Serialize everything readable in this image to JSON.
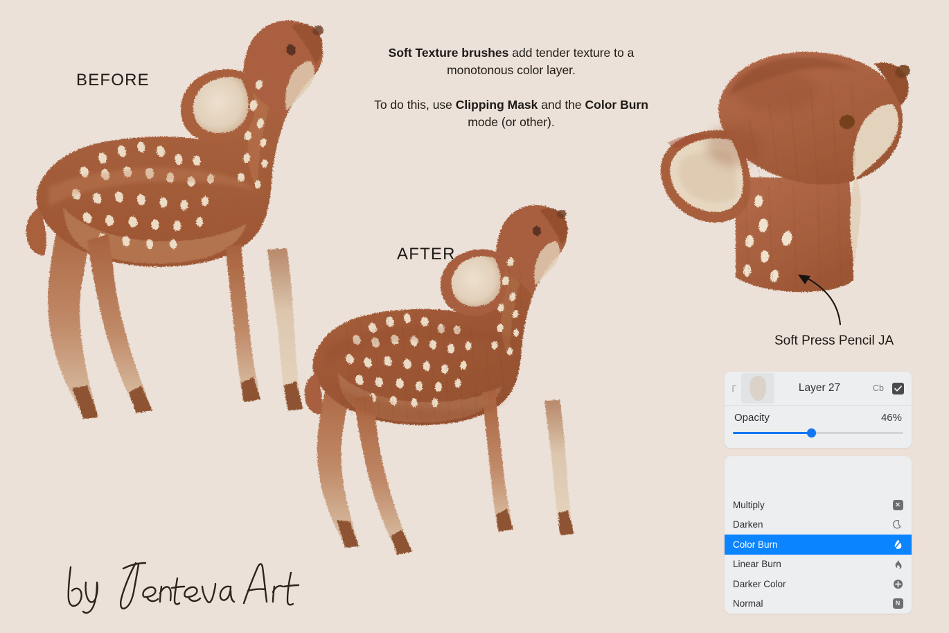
{
  "page": {
    "background_color": "#ece1d8",
    "text_color": "#1d1a17"
  },
  "labels": {
    "before": "BEFORE",
    "after": "AFTER"
  },
  "instructions": {
    "line1_bold": "Soft Texture brushes",
    "line1_rest": " add tender texture to a",
    "line2": "monotonous color layer.",
    "line3_a": "To do this, use ",
    "line3_bold1": "Clipping Mask",
    "line3_b": " and the ",
    "line3_bold2": "Color Burn",
    "line4": "mode (or other)."
  },
  "brush_caption": "Soft Press Pencil JA",
  "signature": "by Jenteva Art",
  "layer_panel": {
    "clip_glyph": "Γ",
    "layer_name": "Layer 27",
    "blend_tag": "Cb",
    "visible_checked": true,
    "opacity": {
      "label": "Opacity",
      "value_text": "46%",
      "value": 46,
      "accent_color": "#1277f5"
    },
    "blend_modes": [
      {
        "label": "Multiply",
        "icon": "multiply-icon",
        "selected": false
      },
      {
        "label": "Darken",
        "icon": "moon-icon",
        "selected": false
      },
      {
        "label": "Color Burn",
        "icon": "droplet-icon",
        "selected": true
      },
      {
        "label": "Linear Burn",
        "icon": "flame-icon",
        "selected": false
      },
      {
        "label": "Darker Color",
        "icon": "plus-circle-icon",
        "selected": false
      },
      {
        "label": "Normal",
        "icon": "normal-n-icon",
        "selected": false
      }
    ],
    "selected_color": "#0a84ff"
  },
  "artwork": {
    "palette": {
      "body_brown": "#a9603c",
      "body_brown_dark": "#8e4c2e",
      "body_brown_light": "#bc7a55",
      "belly_cream": "#e4d3c0",
      "ear_inner": "#e8d8c4",
      "spot_cream": "#ecdcc6",
      "hoof_dark": "#7d4427",
      "outline": "#6f4226",
      "eye": "#5e3520",
      "nose": "#6b3c22"
    },
    "figures": [
      {
        "name": "deer-before",
        "label": "BEFORE"
      },
      {
        "name": "deer-after",
        "label": "AFTER"
      },
      {
        "name": "deer-head-detail",
        "label": "Soft Press Pencil JA"
      }
    ]
  }
}
